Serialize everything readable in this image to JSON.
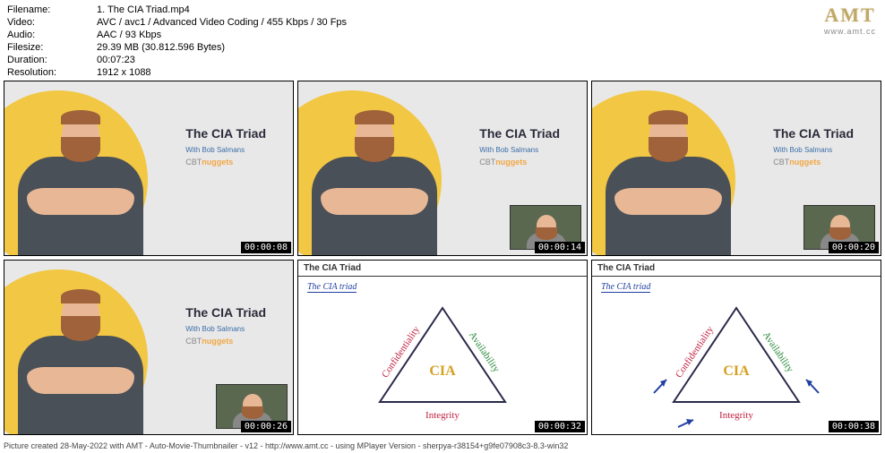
{
  "meta": {
    "filename_label": "Filename:",
    "filename": "1. The CIA Triad.mp4",
    "video_label": "Video:",
    "video": "AVC / avc1 / Advanced Video Coding / 455 Kbps / 30 Fps",
    "audio_label": "Audio:",
    "audio": "AAC / 93 Kbps",
    "filesize_label": "Filesize:",
    "filesize": "29.39 MB (30.812.596 Bytes)",
    "duration_label": "Duration:",
    "duration": "00:07:23",
    "resolution_label": "Resolution:",
    "resolution": "1912 x 1088"
  },
  "logo": {
    "text": "AMT",
    "url": "www.amt.cc"
  },
  "thumbs": [
    {
      "ts": "00:00:08",
      "type": "intro",
      "pip": false
    },
    {
      "ts": "00:00:14",
      "type": "intro",
      "pip": true
    },
    {
      "ts": "00:00:20",
      "type": "intro",
      "pip": true
    },
    {
      "ts": "00:00:26",
      "type": "intro",
      "pip": true
    },
    {
      "ts": "00:00:32",
      "type": "wb",
      "arrows": false
    },
    {
      "ts": "00:00:38",
      "type": "wb",
      "arrows": true
    }
  ],
  "slide": {
    "title": "The CIA Triad",
    "subtitle": "With Bob Salmans",
    "brand_prefix": "CBT",
    "brand_suffix": "nuggets"
  },
  "whiteboard": {
    "bar_title": "The CIA Triad",
    "hand_title": "The CIA triad",
    "center": "CIA",
    "left": "Confidentiality",
    "right": "Availability",
    "bottom": "Integrity"
  },
  "footer": "Picture created 28-May-2022 with AMT - Auto-Movie-Thumbnailer - v12 - http://www.amt.cc - using MPlayer Version - sherpya-r38154+g9fe07908c3-8.3-win32"
}
